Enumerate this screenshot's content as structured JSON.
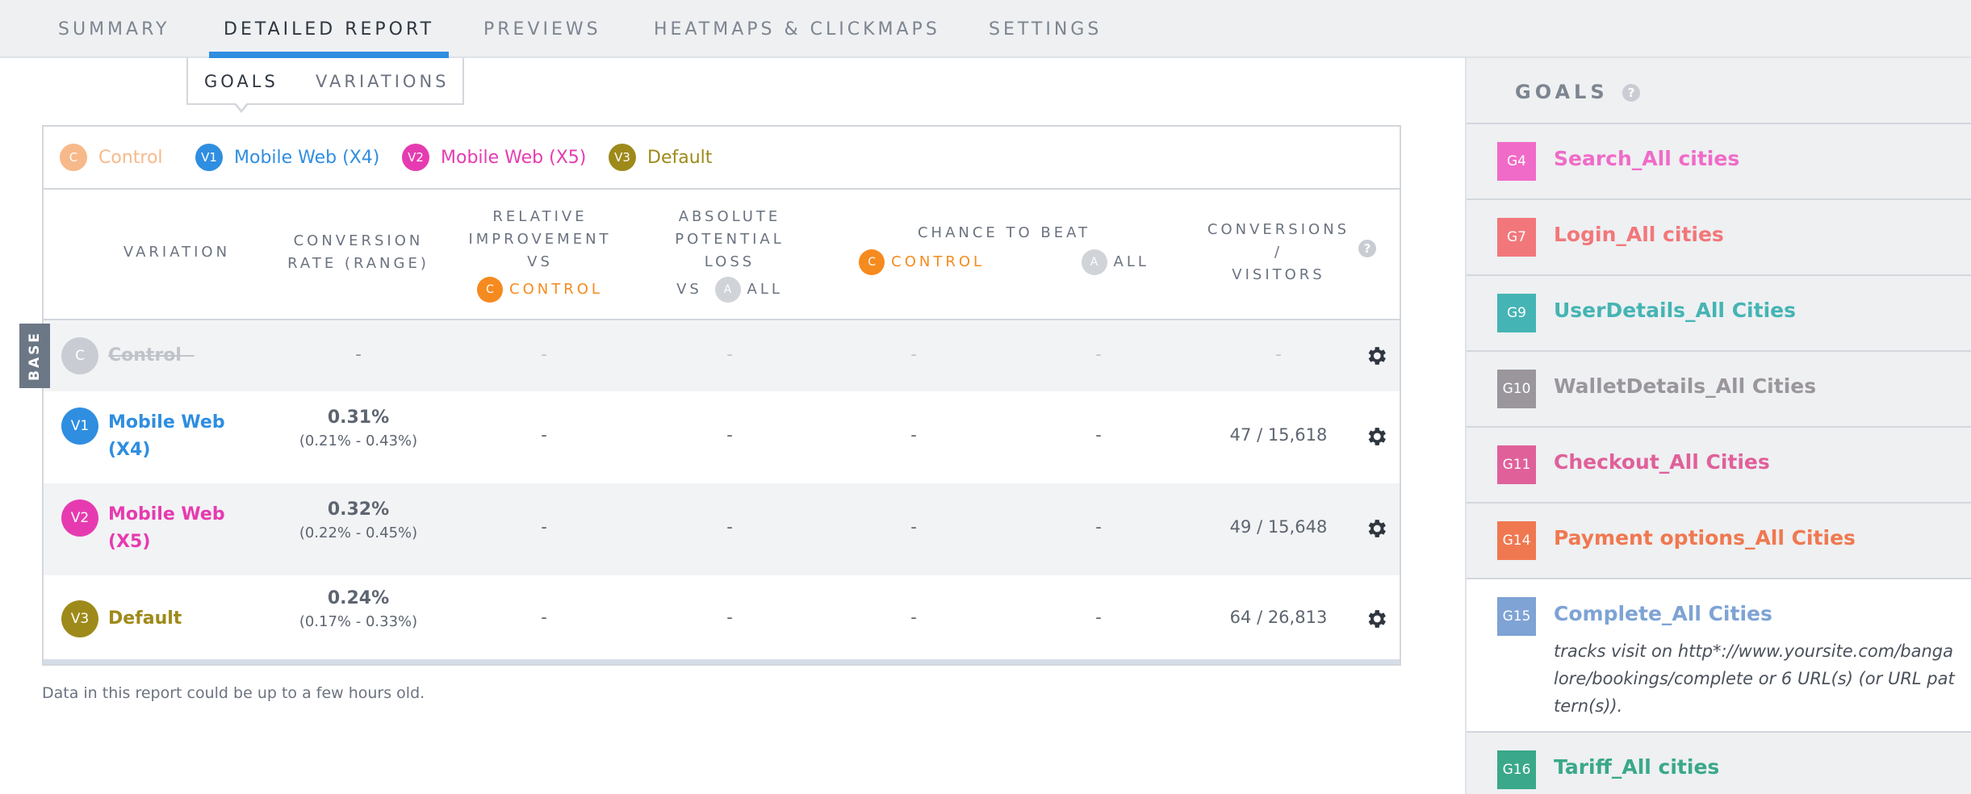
{
  "top_tabs": [
    "SUMMARY",
    "DETAILED REPORT",
    "PREVIEWS",
    "HEATMAPS & CLICKMAPS",
    "SETTINGS"
  ],
  "sub_tabs": [
    "GOALS",
    "VARIATIONS"
  ],
  "legend": [
    {
      "badge": "C",
      "label": "Control",
      "color": "#f7b98a"
    },
    {
      "badge": "V1",
      "label": "Mobile Web (X4)",
      "color": "#2f8ee0"
    },
    {
      "badge": "V2",
      "label": "Mobile Web (X5)",
      "color": "#e63bb0"
    },
    {
      "badge": "V3",
      "label": "Default",
      "color": "#9e8a1a"
    }
  ],
  "headers": {
    "variation": "VARIATION",
    "conversion_rate": [
      "CONVERSION",
      "RATE (RANGE)"
    ],
    "relative": [
      "RELATIVE",
      "IMPROVEMENT",
      "VS"
    ],
    "relative_control": "CONTROL",
    "absolute": [
      "ABSOLUTE",
      "POTENTIAL",
      "LOSS"
    ],
    "absolute_vs": "VS",
    "absolute_all": "ALL",
    "chance": "CHANCE TO BEAT",
    "chance_control": "CONTROL",
    "chance_all": "ALL",
    "conversions": [
      "CONVERSIONS",
      "/",
      "VISITORS"
    ],
    "badge_c": "C",
    "badge_a": "A",
    "help": "?"
  },
  "base_label": "BASE",
  "rows": [
    {
      "badge": "C",
      "name": "Control",
      "suffix": "-",
      "rate": "-",
      "range": "",
      "rel": "-",
      "abs": "-",
      "chance_c": "-",
      "chance_a": "-",
      "conv": "-",
      "color": "#c9cdd3"
    },
    {
      "badge": "V1",
      "name_lines": [
        "Mobile Web",
        "(X4)"
      ],
      "rate": "0.31%",
      "range": "(0.21% - 0.43%)",
      "rel": "-",
      "abs": "-",
      "chance_c": "-",
      "chance_a": "-",
      "conv": "47 / 15,618",
      "color": "#2f8ee0"
    },
    {
      "badge": "V2",
      "name_lines": [
        "Mobile Web",
        "(X5)"
      ],
      "rate": "0.32%",
      "range": "(0.22% - 0.45%)",
      "rel": "-",
      "abs": "-",
      "chance_c": "-",
      "chance_a": "-",
      "conv": "49 / 15,648",
      "color": "#e63bb0"
    },
    {
      "badge": "V3",
      "name": "Default",
      "rate": "0.24%",
      "range": "(0.17% - 0.33%)",
      "rel": "-",
      "abs": "-",
      "chance_c": "-",
      "chance_a": "-",
      "conv": "64 / 26,813",
      "color": "#9e8a1a"
    }
  ],
  "footnote": "Data in this report could be up to a few hours old.",
  "goals": {
    "title": "GOALS",
    "help": "?",
    "items": [
      {
        "badge": "G4",
        "name": "Search_All cities",
        "color": "#f06bc8"
      },
      {
        "badge": "G7",
        "name": "Login_All cities",
        "color": "#f2777a"
      },
      {
        "badge": "G9",
        "name": "UserDetails_All Cities",
        "color": "#45b4b4"
      },
      {
        "badge": "G10",
        "name": "WalletDetails_All Cities",
        "color": "#9a969c"
      },
      {
        "badge": "G11",
        "name": "Checkout_All Cities",
        "color": "#e0609a"
      },
      {
        "badge": "G14",
        "name": "Payment options_All Cities",
        "color": "#f07850"
      },
      {
        "badge": "G15",
        "name": "Complete_All Cities",
        "color": "#7ea3d4",
        "description": "tracks visit on http*://www.yoursite.com/bangalore/bookings/complete or 6 URL(s) (or URL pattern(s))."
      },
      {
        "badge": "G16",
        "name": "Tariff_All cities",
        "color": "#3aa88a"
      }
    ]
  },
  "colors": {
    "accent": "#2f8ee0",
    "control_orange": "#f58a1f"
  }
}
